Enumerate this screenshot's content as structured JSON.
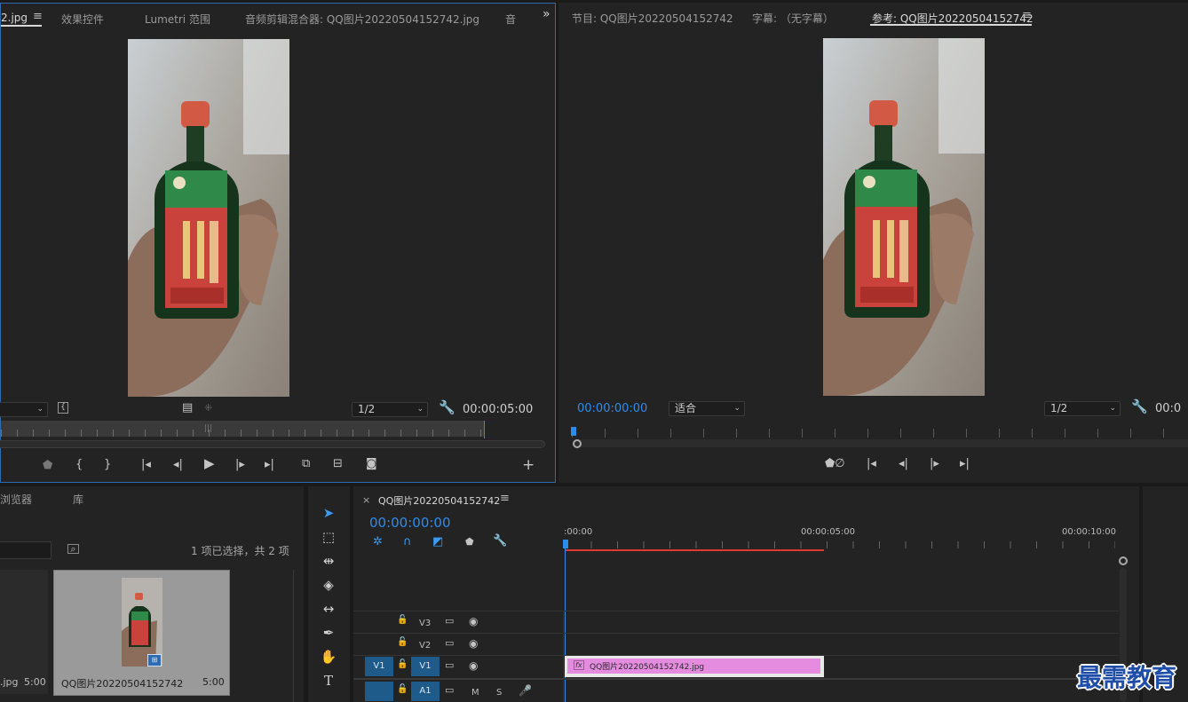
{
  "source_monitor": {
    "tabs": [
      "2.jpg",
      "效果控件",
      "Lumetri 范围",
      "音频剪辑混合器: QQ图片20220504152742.jpg",
      "音 "
    ],
    "overflow_icon": "chevron-double-right-icon",
    "resolution": "1/2",
    "timecode": "00:00:05:00"
  },
  "program_monitor": {
    "tabs": [
      "节目: QQ图片20220504152742",
      "字幕: （无字幕）",
      "参考: QQ图片20220504152742"
    ],
    "timecode": "00:00:00:00",
    "fit": "适合",
    "resolution": "1/2",
    "timecode_right": "00:0"
  },
  "project": {
    "tabs": [
      "浏览器",
      "库"
    ],
    "selection_info": "1 项已选择，共 2 项",
    "item_left_name": ".jpg",
    "item_left_duration": "5:00",
    "item_name": "QQ图片20220504152742",
    "item_duration": "5:00"
  },
  "timeline": {
    "close": "×",
    "sequence_name": "QQ图片20220504152742",
    "timecode": "00:00:00:00",
    "ruler_labels": [
      ":00:00",
      "00:00:05:00",
      "00:00:10:00"
    ],
    "tracks": [
      {
        "name": "V3"
      },
      {
        "name": "V2"
      },
      {
        "name": "V1",
        "target": "V1"
      },
      {
        "name": "A1",
        "target": "",
        "m": "M",
        "s": "S"
      }
    ],
    "clip_label": "QQ图片20220504152742.jpg",
    "clip_fx": "fx"
  },
  "watermark": "最需教育",
  "colors": {
    "accent": "#2d8ceb",
    "clip": "#e58be0",
    "playhead_red": "#e03a2e"
  }
}
